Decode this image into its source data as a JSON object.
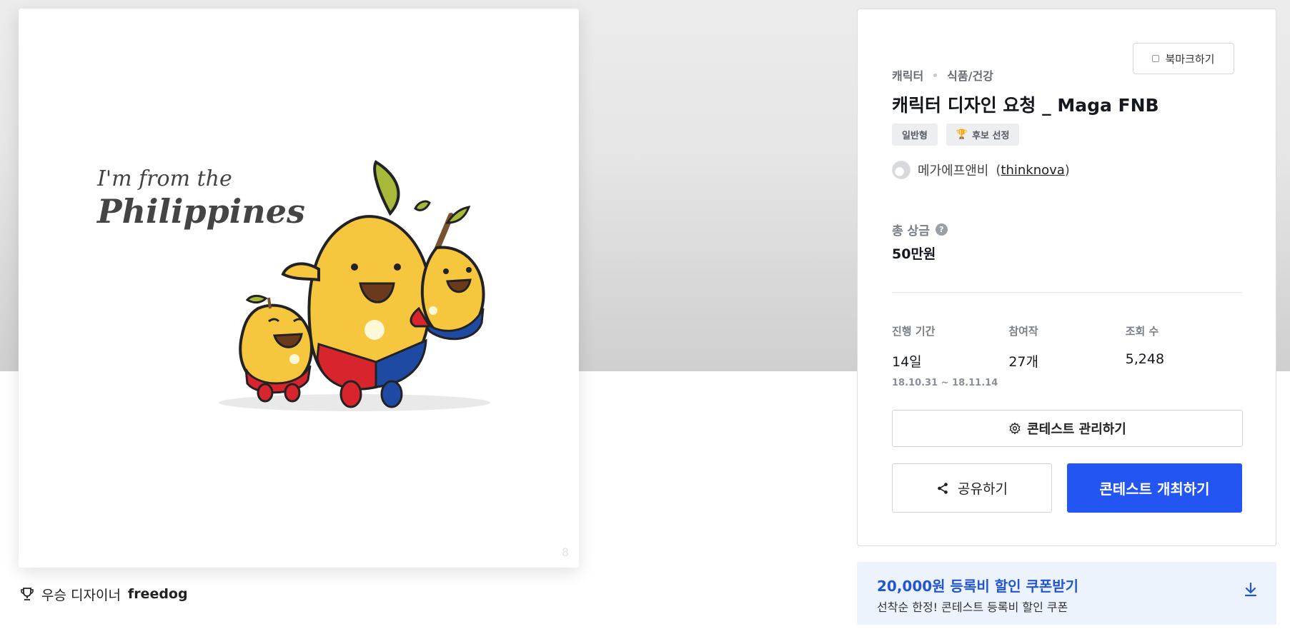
{
  "left": {
    "image_text_line1": "I'm from the",
    "image_text_line2": "Philippines",
    "page_indicator": "8",
    "winner_label": "우승 디자이너",
    "winner_name": "freedog"
  },
  "panel": {
    "breadcrumb": [
      "캐릭터",
      "식품/건강"
    ],
    "bookmark_label": "북마크하기",
    "title": "캐릭터 디자인 요청 _ Maga FNB",
    "tags": [
      "일반형",
      "후보 선정"
    ],
    "host_name": "메가에프앤비",
    "host_handle": "thinknova",
    "prize_label": "총 상금",
    "prize_help": "?",
    "prize_value": "50만원",
    "stats": [
      {
        "label": "진행 기간",
        "value": "14일",
        "sub": "18.10.31 ~ 18.11.14"
      },
      {
        "label": "참여작",
        "value": "27개",
        "sub": ""
      },
      {
        "label": "조회 수",
        "value": "5,248",
        "sub": ""
      }
    ],
    "manage_label": "콘테스트 관리하기",
    "share_label": "공유하기",
    "host_contest_label": "콘테스트 개최하기"
  },
  "coupon": {
    "title": "20,000원 등록비 할인 쿠폰받기",
    "subtitle": "선착순 한정! 콘테스트 등록비 할인 쿠폰"
  },
  "colors": {
    "primary": "#2255f2",
    "coupon_bg": "#edf3fd",
    "coupon_text": "#2255d4"
  }
}
